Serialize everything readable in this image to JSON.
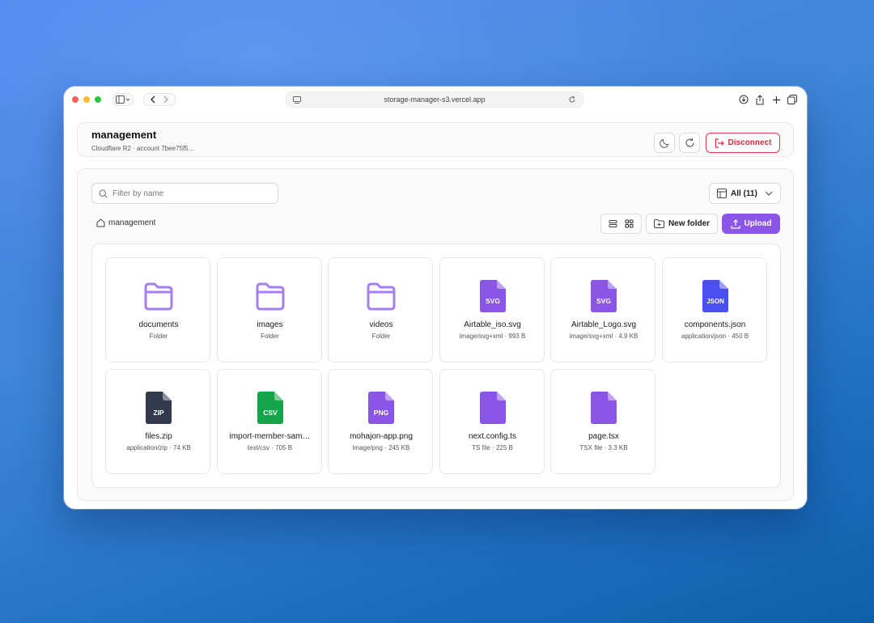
{
  "browser": {
    "url": "storage-manager-s3.vercel.app"
  },
  "header": {
    "title": "management",
    "subtitle": "Cloudflare R2 · account 7bee75f5…",
    "disconnect_label": "Disconnect"
  },
  "toolbar": {
    "filter_placeholder": "Filter by name",
    "filter_value": "",
    "type_filter_selected": "All (11)",
    "breadcrumb_root": "management",
    "new_folder_label": "New folder",
    "upload_label": "Upload"
  },
  "colors": {
    "accent": "#8b55e8",
    "danger": "#e0283a",
    "folder": "#a57ff0",
    "svg_file": "#8b55e8",
    "json_file": "#4b4ff0",
    "zip_file": "#333a4d",
    "csv_file": "#16a34a",
    "png_file": "#8b55e8",
    "generic_file": "#8b55e8"
  },
  "items": [
    {
      "name": "documents",
      "meta": "Folder",
      "kind": "folder",
      "badge": ""
    },
    {
      "name": "images",
      "meta": "Folder",
      "kind": "folder",
      "badge": ""
    },
    {
      "name": "videos",
      "meta": "Folder",
      "kind": "folder",
      "badge": ""
    },
    {
      "name": "Airtable_iso.svg",
      "meta": "image/svg+xml · 993 B",
      "kind": "file",
      "badge": "SVG",
      "color": "#8b55e8"
    },
    {
      "name": "Airtable_Logo.svg",
      "meta": "image/svg+xml · 4.9 KB",
      "kind": "file",
      "badge": "SVG",
      "color": "#8b55e8"
    },
    {
      "name": "components.json",
      "meta": "application/json · 450 B",
      "kind": "file",
      "badge": "JSON",
      "color": "#4b4ff0"
    },
    {
      "name": "files.zip",
      "meta": "application/zip · 74 KB",
      "kind": "file",
      "badge": "ZIP",
      "color": "#333a4d"
    },
    {
      "name": "import-member-sam…",
      "meta": "text/csv · 705 B",
      "kind": "file",
      "badge": "CSV",
      "color": "#16a34a"
    },
    {
      "name": "mohajon-app.png",
      "meta": "image/png · 245 KB",
      "kind": "file",
      "badge": "PNG",
      "color": "#8b55e8"
    },
    {
      "name": "next.config.ts",
      "meta": "TS file · 225 B",
      "kind": "file",
      "badge": "",
      "color": "#8b55e8"
    },
    {
      "name": "page.tsx",
      "meta": "TSX file · 3.3 KB",
      "kind": "file",
      "badge": "",
      "color": "#8b55e8"
    }
  ]
}
